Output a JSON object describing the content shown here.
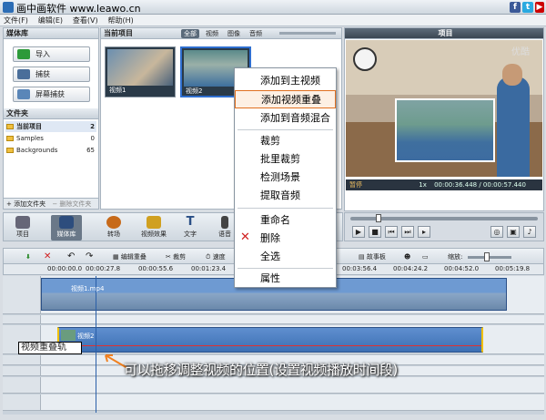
{
  "titlebar": {
    "title": "画中画软件 www.leawo.cn"
  },
  "menu": [
    "文件(F)",
    "编辑(E)",
    "查看(V)",
    "帮助(H)"
  ],
  "library": {
    "header": "媒体库",
    "buttons": [
      "导入",
      "捕获",
      "屏幕捕获"
    ],
    "folder_header": "文件夹",
    "folders": [
      {
        "name": "当前项目",
        "count": "2"
      },
      {
        "name": "Samples",
        "count": "0"
      },
      {
        "name": "Backgrounds",
        "count": "65"
      }
    ],
    "add_folder": "+ 添加文件夹",
    "delete_folder": "− 删除文件夹"
  },
  "media": {
    "header": "当前项目",
    "filters": [
      "全部",
      "视频",
      "图像",
      "音频"
    ],
    "clips": [
      "视频1",
      "视频2"
    ]
  },
  "preview": {
    "header": "项目",
    "watermark": "优酷",
    "status": "暂停",
    "speed": "1x",
    "time": "00:00:36.448 / 00:00:57.440"
  },
  "toolbar": {
    "buttons": [
      "项目",
      "媒体库",
      "转场",
      "视频效果",
      "文字",
      "语音"
    ]
  },
  "timeline_tools": {
    "edit_overlay": "编辑重叠",
    "crop": "裁剪",
    "speed": "速度",
    "storyboard": "故事板",
    "zoom": "缩放:"
  },
  "ruler": [
    "00:00:00.0",
    "00:00:27.8",
    "00:00:55.6",
    "00:01:23.4",
    "00:03:56.4",
    "00:04:24.2",
    "00:04:52.0",
    "00:05:19.8"
  ],
  "tracks": {
    "main_clip": "视频1.mp4",
    "overlay_clip": "视频2",
    "overlay_label": "视频重叠轨"
  },
  "context_menu": {
    "items": [
      "添加到主视频",
      "添加视频重叠",
      "添加到音频混合",
      "裁剪",
      "批里裁剪",
      "检测场景",
      "提取音频",
      "重命名",
      "删除",
      "全选",
      "属性"
    ],
    "highlighted": "添加视频重叠"
  },
  "annotation": "可以拖移调整视频的位置(设置视频播放时间段)",
  "colors": {
    "accent": "#3c6fb3",
    "highlight": "#e07020",
    "delete": "#d02020"
  }
}
